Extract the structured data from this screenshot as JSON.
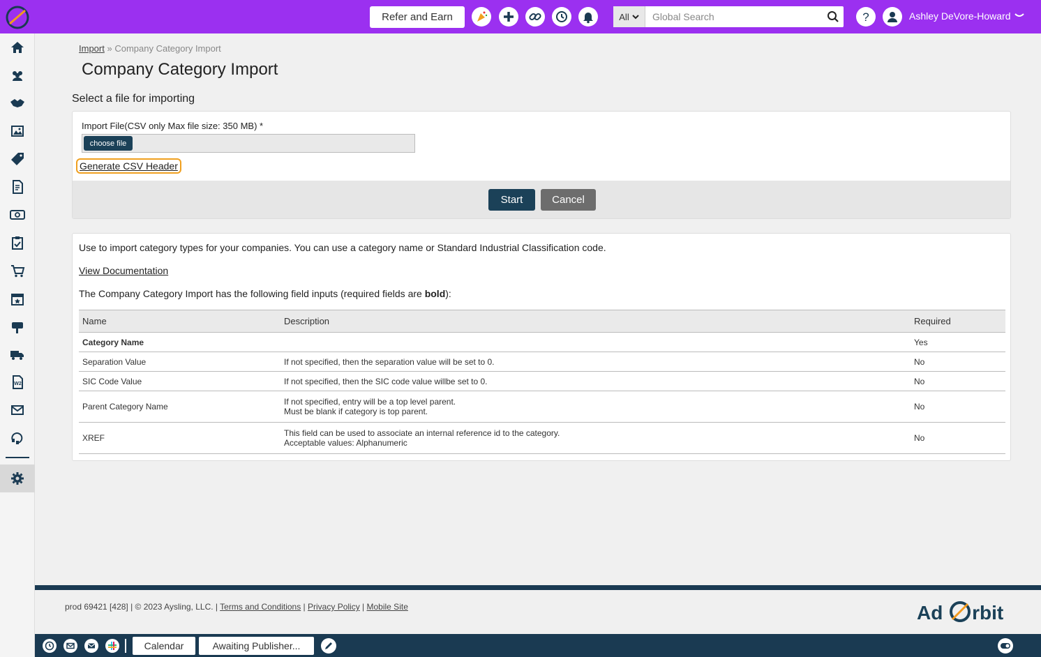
{
  "topbar": {
    "refer_label": "Refer and Earn",
    "search_scope": "All",
    "search_placeholder": "Global Search",
    "user_name": "Ashley DeVore-Howard"
  },
  "breadcrumb": {
    "parent": "Import",
    "separator": "»",
    "current": "Company Category Import"
  },
  "page": {
    "title": "Company Category Import",
    "section_title": "Select a file for importing"
  },
  "upload": {
    "label": "Import File(CSV only Max file size: 350 MB) *",
    "choose_label": "choose file",
    "generate_link": "Generate CSV Header",
    "start_label": "Start",
    "cancel_label": "Cancel"
  },
  "info": {
    "description": "Use to import category types for your companies. You can use a category name or Standard Industrial Classification code.",
    "doc_link": "View Documentation",
    "fields_intro_pre": "The Company Category Import has the following field inputs (required fields are ",
    "fields_intro_bold": "bold",
    "fields_intro_post": "):",
    "columns": [
      "Name",
      "Description",
      "Required"
    ],
    "rows": [
      {
        "name": "Category Name",
        "desc1": "",
        "desc2": "",
        "required": "Yes",
        "bold": true
      },
      {
        "name": "Separation Value",
        "desc1": "If not specified, then the separation value will be set to 0.",
        "desc2": "",
        "required": "No",
        "bold": false
      },
      {
        "name": "SIC Code Value",
        "desc1": "If not specified, then the SIC code value willbe set to 0.",
        "desc2": "",
        "required": "No",
        "bold": false
      },
      {
        "name": "Parent Category Name",
        "desc1": "If not specified, entry will be a top level parent.",
        "desc2": "Must be blank if category is top parent.",
        "required": "No",
        "bold": false
      },
      {
        "name": "XREF",
        "desc1": "This field can be used to associate an internal reference id to the category.",
        "desc2": "Acceptable values: Alphanumeric",
        "required": "No",
        "bold": false
      }
    ]
  },
  "footer": {
    "build": "prod 69421 [428]",
    "copyright": "© 2023 Aysling, LLC.",
    "terms": "Terms and Conditions",
    "privacy": "Privacy Policy",
    "mobile": "Mobile Site",
    "brand_left": "Ad",
    "brand_right": "rbit"
  },
  "bottombar": {
    "tab1": "Calendar",
    "tab2": "Awaiting Publisher..."
  },
  "colors": {
    "topbar": "#9b30f0",
    "primary": "#1b4158",
    "highlight": "#f0a020",
    "cancel": "#6d6d6d"
  },
  "icons": [
    "logo-icon",
    "party-icon",
    "plus-icon",
    "link-icon",
    "history-icon",
    "bell-icon",
    "search-icon",
    "help-icon",
    "user-icon",
    "home-icon",
    "contacts-icon",
    "deals-icon",
    "media-icon",
    "tag-icon",
    "invoice-icon",
    "money-icon",
    "tasks-icon",
    "cart-icon",
    "calendar-icon",
    "mailbox-icon",
    "truck-icon",
    "w2-icon",
    "mail-icon",
    "support-icon",
    "gear-icon"
  ]
}
